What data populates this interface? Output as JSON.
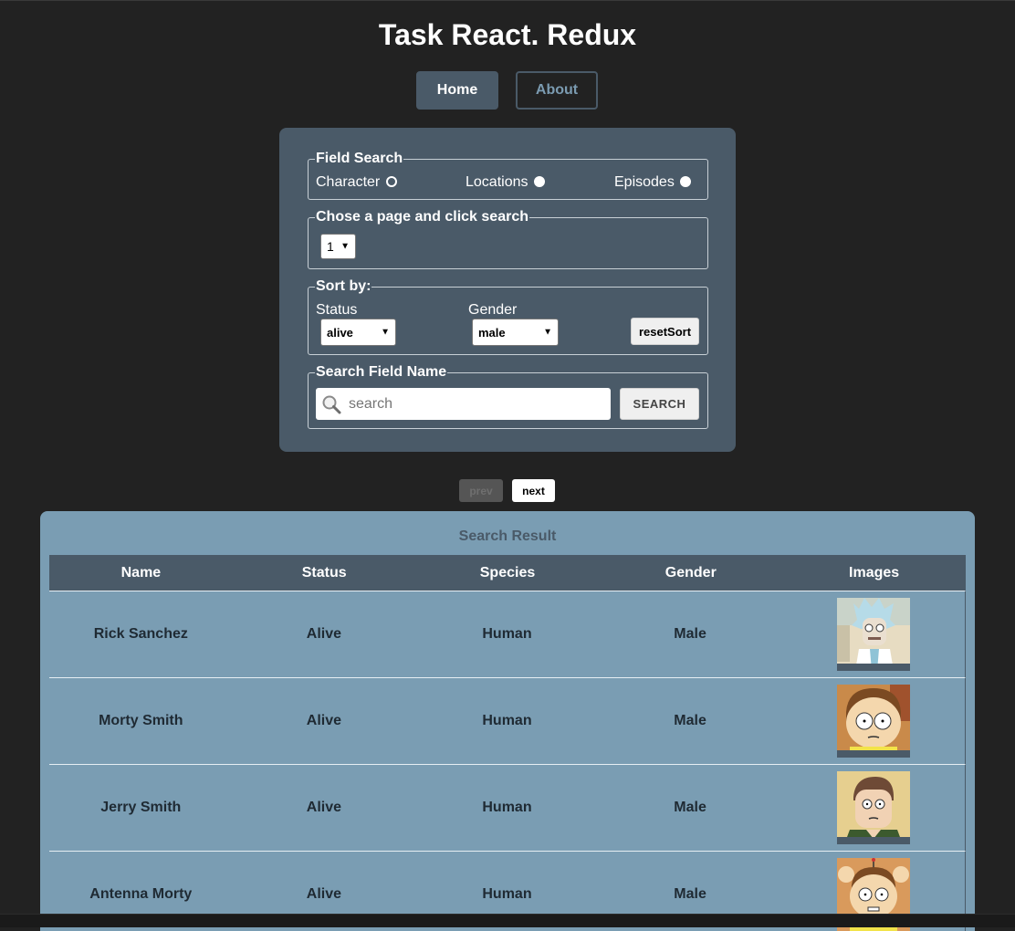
{
  "app": {
    "title": "Task React. Redux"
  },
  "nav": {
    "home": "Home",
    "about": "About"
  },
  "search_panel": {
    "field_search": {
      "legend": "Field Search",
      "options": [
        {
          "label": "Character",
          "selected": true
        },
        {
          "label": "Locations",
          "selected": false
        },
        {
          "label": "Episodes",
          "selected": false
        }
      ]
    },
    "page_select": {
      "legend": "Chose a page and click search",
      "value": "1"
    },
    "sort": {
      "legend": "Sort by:",
      "status_label": "Status",
      "status_value": "alive",
      "gender_label": "Gender",
      "gender_value": "male",
      "reset_label": "resetSort"
    },
    "name_search": {
      "legend": "Search Field Name",
      "placeholder": "search",
      "button": "SEARCH"
    }
  },
  "pagination": {
    "prev": "prev",
    "next": "next"
  },
  "results": {
    "title": "Search Result",
    "columns": [
      "Name",
      "Status",
      "Species",
      "Gender",
      "Images"
    ],
    "rows": [
      {
        "name": "Rick Sanchez",
        "status": "Alive",
        "species": "Human",
        "gender": "Male",
        "image": "rick-sanchez-portrait"
      },
      {
        "name": "Morty Smith",
        "status": "Alive",
        "species": "Human",
        "gender": "Male",
        "image": "morty-smith-portrait"
      },
      {
        "name": "Jerry Smith",
        "status": "Alive",
        "species": "Human",
        "gender": "Male",
        "image": "jerry-smith-portrait"
      },
      {
        "name": "Antenna Morty",
        "status": "Alive",
        "species": "Human",
        "gender": "Male",
        "image": "antenna-morty-portrait"
      }
    ]
  },
  "colors": {
    "background": "#222222",
    "panel": "#4a5a68",
    "results_bg": "#7a9db3",
    "accent_text": "#7b9bb1"
  }
}
